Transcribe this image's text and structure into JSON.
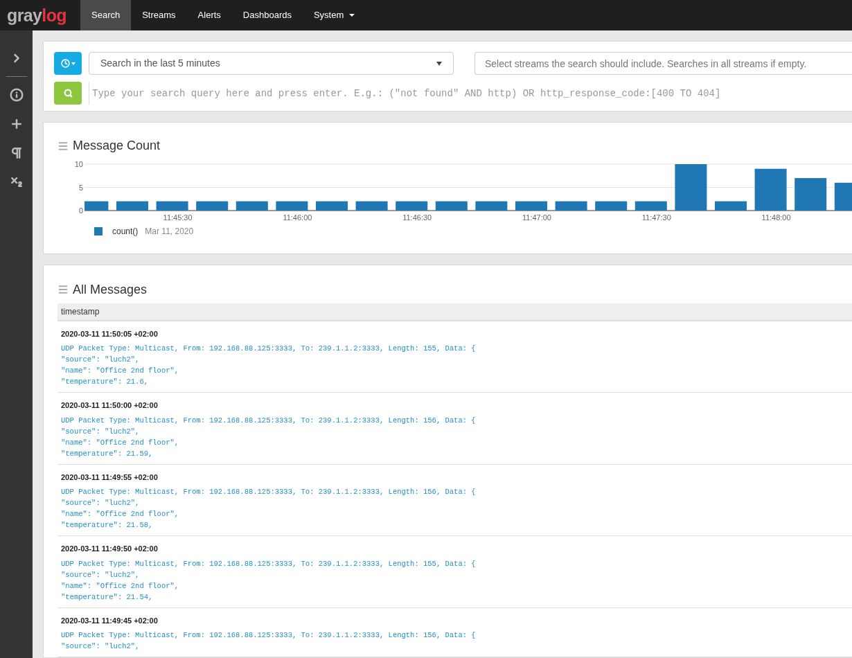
{
  "navbar": {
    "logo": {
      "part_1": "gray",
      "part_2": "log"
    },
    "items": [
      {
        "label": "Search",
        "selected": true,
        "dropdown": false
      },
      {
        "label": "Streams",
        "selected": false,
        "dropdown": false
      },
      {
        "label": "Alerts",
        "selected": false,
        "dropdown": false
      },
      {
        "label": "Dashboards",
        "selected": false,
        "dropdown": false
      },
      {
        "label": "System",
        "selected": false,
        "dropdown": true
      }
    ]
  },
  "sidebar": {
    "items": [
      {
        "kind": "chevron"
      },
      {
        "kind": "info"
      },
      {
        "kind": "plus"
      },
      {
        "kind": "pilcrow"
      },
      {
        "kind": "subscript"
      }
    ]
  },
  "search": {
    "time_range": "Search in the last 5 minutes",
    "streams": {
      "placeholder": "Select streams the search should include. Searches in all streams if empty."
    },
    "query": {
      "placeholder": "Type your search query here and press enter. E.g.: (\"not found\" AND http) OR http_response_code:[400 TO 404]"
    }
  },
  "message_count": {
    "title": "Message Count",
    "legend": {
      "date": "Mar 11, 2020"
    },
    "chart_data": {
      "type": "bar",
      "categories": [
        null,
        null,
        "11:45:30",
        null,
        null,
        "11:46:00",
        null,
        null,
        "11:46:30",
        null,
        null,
        "11:47:00",
        null,
        null,
        "11:47:30",
        null,
        null,
        "11:48:00",
        null,
        null
      ],
      "series": [
        {
          "name": "count()",
          "color": "#1f77b4",
          "values": [
            2,
            2,
            2,
            2,
            2,
            2,
            2,
            2,
            2,
            2,
            2,
            2,
            2,
            2,
            2,
            10,
            2,
            9,
            7,
            6
          ]
        }
      ],
      "ylim": [
        0,
        10
      ],
      "yticks": [
        0,
        5,
        10
      ]
    }
  },
  "all_messages": {
    "title": "All Messages",
    "columns": [
      "timestamp"
    ],
    "rows": [
      {
        "timestamp": "2020-03-11 11:50:05 +02:00",
        "lines": [
          "UDP Packet Type: Multicast, From: 192.168.88.125:3333, To: 239.1.1.2:3333, Length: 155, Data: {",
          "\"source\": \"luch2\",",
          "\"name\": \"Office 2nd floor\",",
          "\"temperature\": 21.6,"
        ]
      },
      {
        "timestamp": "2020-03-11 11:50:00 +02:00",
        "lines": [
          "UDP Packet Type: Multicast, From: 192.168.88.125:3333, To: 239.1.1.2:3333, Length: 156, Data: {",
          "\"source\": \"luch2\",",
          "\"name\": \"Office 2nd floor\",",
          "\"temperature\": 21.59,"
        ]
      },
      {
        "timestamp": "2020-03-11 11:49:55 +02:00",
        "lines": [
          "UDP Packet Type: Multicast, From: 192.168.88.125:3333, To: 239.1.1.2:3333, Length: 156, Data: {",
          "\"source\": \"luch2\",",
          "\"name\": \"Office 2nd floor\",",
          "\"temperature\": 21.58,"
        ]
      },
      {
        "timestamp": "2020-03-11 11:49:50 +02:00",
        "lines": [
          "UDP Packet Type: Multicast, From: 192.168.88.125:3333, To: 239.1.1.2:3333, Length: 155, Data: {",
          "\"source\": \"luch2\",",
          "\"name\": \"Office 2nd floor\",",
          "\"temperature\": 21.54,"
        ]
      },
      {
        "timestamp": "2020-03-11 11:49:45 +02:00",
        "lines": [
          "UDP Packet Type: Multicast, From: 192.168.88.125:3333, To: 239.1.1.2:3333, Length: 156, Data: {",
          "\"source\": \"luch2\","
        ]
      }
    ]
  }
}
